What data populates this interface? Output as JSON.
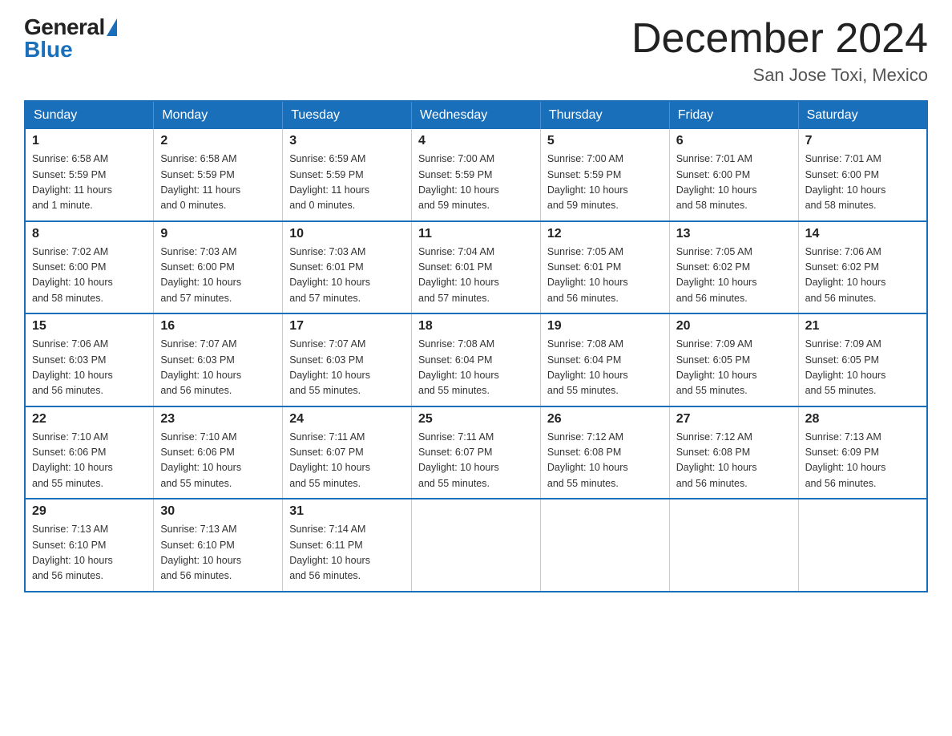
{
  "logo": {
    "general": "General",
    "blue": "Blue",
    "triangle": "▲"
  },
  "title": {
    "month": "December 2024",
    "location": "San Jose Toxi, Mexico"
  },
  "headers": [
    "Sunday",
    "Monday",
    "Tuesday",
    "Wednesday",
    "Thursday",
    "Friday",
    "Saturday"
  ],
  "weeks": [
    [
      {
        "day": "1",
        "info": "Sunrise: 6:58 AM\nSunset: 5:59 PM\nDaylight: 11 hours\nand 1 minute."
      },
      {
        "day": "2",
        "info": "Sunrise: 6:58 AM\nSunset: 5:59 PM\nDaylight: 11 hours\nand 0 minutes."
      },
      {
        "day": "3",
        "info": "Sunrise: 6:59 AM\nSunset: 5:59 PM\nDaylight: 11 hours\nand 0 minutes."
      },
      {
        "day": "4",
        "info": "Sunrise: 7:00 AM\nSunset: 5:59 PM\nDaylight: 10 hours\nand 59 minutes."
      },
      {
        "day": "5",
        "info": "Sunrise: 7:00 AM\nSunset: 5:59 PM\nDaylight: 10 hours\nand 59 minutes."
      },
      {
        "day": "6",
        "info": "Sunrise: 7:01 AM\nSunset: 6:00 PM\nDaylight: 10 hours\nand 58 minutes."
      },
      {
        "day": "7",
        "info": "Sunrise: 7:01 AM\nSunset: 6:00 PM\nDaylight: 10 hours\nand 58 minutes."
      }
    ],
    [
      {
        "day": "8",
        "info": "Sunrise: 7:02 AM\nSunset: 6:00 PM\nDaylight: 10 hours\nand 58 minutes."
      },
      {
        "day": "9",
        "info": "Sunrise: 7:03 AM\nSunset: 6:00 PM\nDaylight: 10 hours\nand 57 minutes."
      },
      {
        "day": "10",
        "info": "Sunrise: 7:03 AM\nSunset: 6:01 PM\nDaylight: 10 hours\nand 57 minutes."
      },
      {
        "day": "11",
        "info": "Sunrise: 7:04 AM\nSunset: 6:01 PM\nDaylight: 10 hours\nand 57 minutes."
      },
      {
        "day": "12",
        "info": "Sunrise: 7:05 AM\nSunset: 6:01 PM\nDaylight: 10 hours\nand 56 minutes."
      },
      {
        "day": "13",
        "info": "Sunrise: 7:05 AM\nSunset: 6:02 PM\nDaylight: 10 hours\nand 56 minutes."
      },
      {
        "day": "14",
        "info": "Sunrise: 7:06 AM\nSunset: 6:02 PM\nDaylight: 10 hours\nand 56 minutes."
      }
    ],
    [
      {
        "day": "15",
        "info": "Sunrise: 7:06 AM\nSunset: 6:03 PM\nDaylight: 10 hours\nand 56 minutes."
      },
      {
        "day": "16",
        "info": "Sunrise: 7:07 AM\nSunset: 6:03 PM\nDaylight: 10 hours\nand 56 minutes."
      },
      {
        "day": "17",
        "info": "Sunrise: 7:07 AM\nSunset: 6:03 PM\nDaylight: 10 hours\nand 55 minutes."
      },
      {
        "day": "18",
        "info": "Sunrise: 7:08 AM\nSunset: 6:04 PM\nDaylight: 10 hours\nand 55 minutes."
      },
      {
        "day": "19",
        "info": "Sunrise: 7:08 AM\nSunset: 6:04 PM\nDaylight: 10 hours\nand 55 minutes."
      },
      {
        "day": "20",
        "info": "Sunrise: 7:09 AM\nSunset: 6:05 PM\nDaylight: 10 hours\nand 55 minutes."
      },
      {
        "day": "21",
        "info": "Sunrise: 7:09 AM\nSunset: 6:05 PM\nDaylight: 10 hours\nand 55 minutes."
      }
    ],
    [
      {
        "day": "22",
        "info": "Sunrise: 7:10 AM\nSunset: 6:06 PM\nDaylight: 10 hours\nand 55 minutes."
      },
      {
        "day": "23",
        "info": "Sunrise: 7:10 AM\nSunset: 6:06 PM\nDaylight: 10 hours\nand 55 minutes."
      },
      {
        "day": "24",
        "info": "Sunrise: 7:11 AM\nSunset: 6:07 PM\nDaylight: 10 hours\nand 55 minutes."
      },
      {
        "day": "25",
        "info": "Sunrise: 7:11 AM\nSunset: 6:07 PM\nDaylight: 10 hours\nand 55 minutes."
      },
      {
        "day": "26",
        "info": "Sunrise: 7:12 AM\nSunset: 6:08 PM\nDaylight: 10 hours\nand 55 minutes."
      },
      {
        "day": "27",
        "info": "Sunrise: 7:12 AM\nSunset: 6:08 PM\nDaylight: 10 hours\nand 56 minutes."
      },
      {
        "day": "28",
        "info": "Sunrise: 7:13 AM\nSunset: 6:09 PM\nDaylight: 10 hours\nand 56 minutes."
      }
    ],
    [
      {
        "day": "29",
        "info": "Sunrise: 7:13 AM\nSunset: 6:10 PM\nDaylight: 10 hours\nand 56 minutes."
      },
      {
        "day": "30",
        "info": "Sunrise: 7:13 AM\nSunset: 6:10 PM\nDaylight: 10 hours\nand 56 minutes."
      },
      {
        "day": "31",
        "info": "Sunrise: 7:14 AM\nSunset: 6:11 PM\nDaylight: 10 hours\nand 56 minutes."
      },
      null,
      null,
      null,
      null
    ]
  ]
}
